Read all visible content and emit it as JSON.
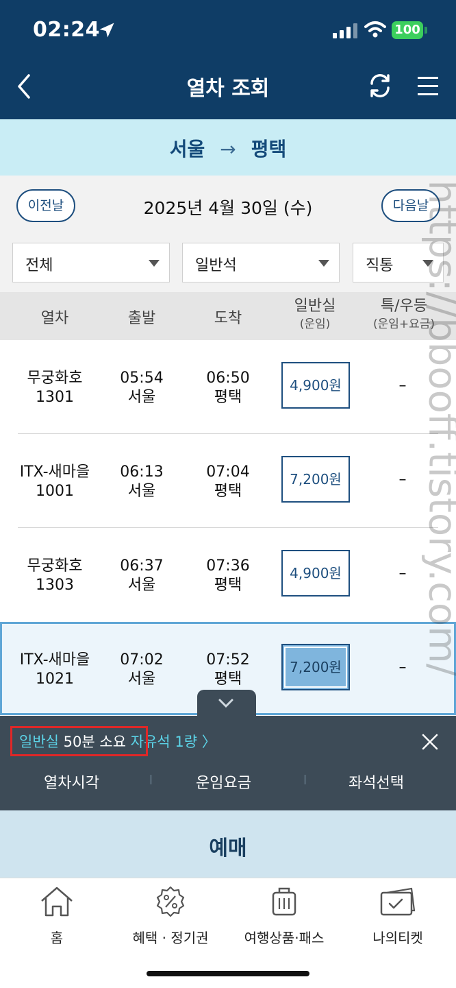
{
  "status_bar": {
    "time": "02:24",
    "battery": "100"
  },
  "header": {
    "title": "열차 조회"
  },
  "route": {
    "from": "서울",
    "to": "평택"
  },
  "date_nav": {
    "prev_label": "이전날",
    "next_label": "다음날",
    "date": "2025년 4월 30일 (수)"
  },
  "filters": [
    {
      "label": "전체"
    },
    {
      "label": "일반석"
    },
    {
      "label": "직통"
    }
  ],
  "table_header": {
    "train": "열차",
    "departure": "출발",
    "arrival": "도착",
    "general": "일반실",
    "general_sub": "(운임)",
    "special": "특/우등",
    "special_sub": "(운임+요금)"
  },
  "trains": [
    {
      "name": "무궁화호",
      "number": "1301",
      "dep_time": "05:54",
      "dep_station": "서울",
      "arr_time": "06:50",
      "arr_station": "평택",
      "fare": "4,900원",
      "special": "–"
    },
    {
      "name": "ITX-새마을",
      "number": "1001",
      "dep_time": "06:13",
      "dep_station": "서울",
      "arr_time": "07:04",
      "arr_station": "평택",
      "fare": "7,200원",
      "special": "–"
    },
    {
      "name": "무궁화호",
      "number": "1303",
      "dep_time": "06:37",
      "dep_station": "서울",
      "arr_time": "07:36",
      "arr_station": "평택",
      "fare": "4,900원",
      "special": "–"
    },
    {
      "name": "ITX-새마을",
      "number": "1021",
      "dep_time": "07:02",
      "dep_station": "서울",
      "arr_time": "07:52",
      "arr_station": "평택",
      "fare": "7,200원",
      "special": "–"
    }
  ],
  "popup": {
    "class_label": "일반실",
    "duration": "50분 소요",
    "standing": "자유석 1량",
    "links": [
      "열차시각",
      "운임요금",
      "좌석선택"
    ]
  },
  "reserve_label": "예매",
  "bottom_nav": [
    {
      "label": "홈",
      "icon": "home-icon"
    },
    {
      "label": "혜택 · 정기권",
      "icon": "discount-badge-icon"
    },
    {
      "label": "여행상품·패스",
      "icon": "suitcase-icon"
    },
    {
      "label": "나의티켓",
      "icon": "ticket-icon"
    }
  ],
  "watermark": "https://bbooff.tistory.com/",
  "colors": {
    "header": "#0f3d66",
    "route_band": "#c9edf5",
    "accent": "#1e4f7f",
    "highlight": "#5cd4e8",
    "battery": "#3ccf5d"
  }
}
